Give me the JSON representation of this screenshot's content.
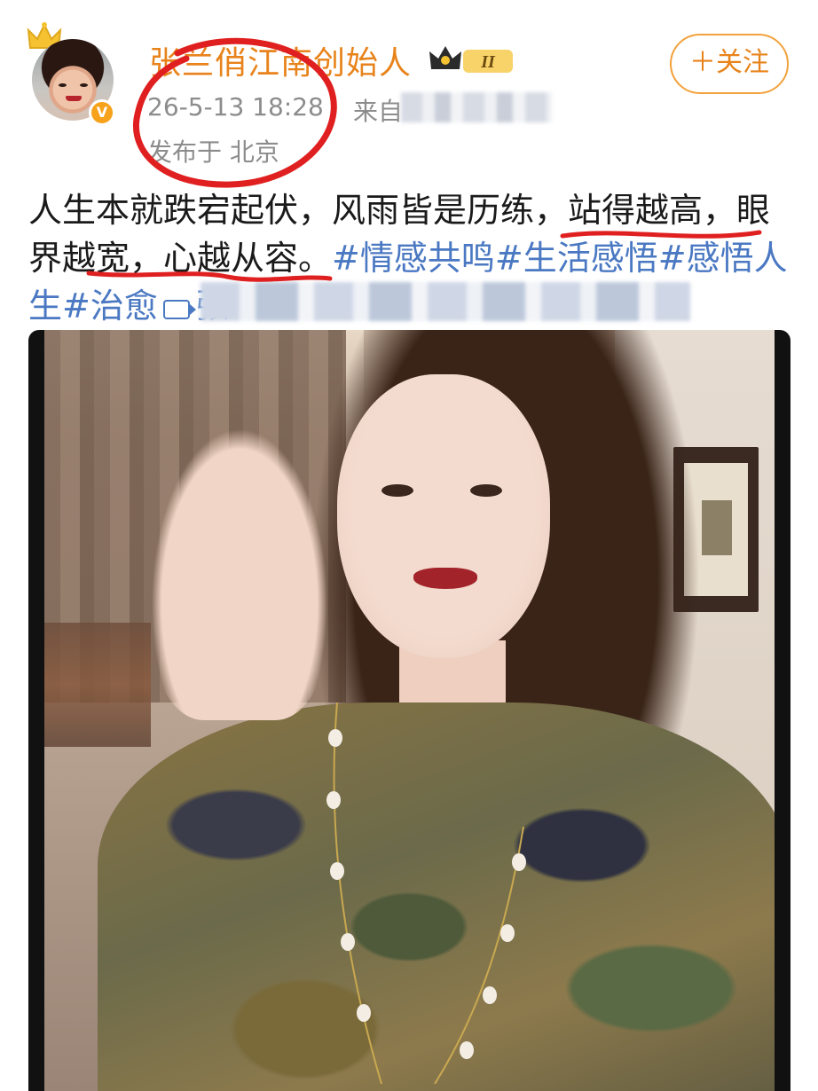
{
  "header": {
    "username": "张兰俏江南创始人",
    "level_badge": "II",
    "post_time": "26-5-13 18:28",
    "post_source": "来自",
    "location": "发布于 北京",
    "follow_label": "＋关注"
  },
  "post": {
    "line1_a": "人生本就跌宕起伏，风雨皆是历练，",
    "line1_b": "站得越高，",
    "line1_c": "眼",
    "line2_a": "界越宽，",
    "line2_b": "心越从容",
    "line2_c": "。",
    "line2_tags": "#情感共鸣#生活感悟#感悟人",
    "line3_tag": "生#治愈",
    "line3_video": "张"
  },
  "colors": {
    "accent": "#e8831b",
    "link": "#4a78c2",
    "annotation_red": "#e02020"
  },
  "icons": [
    "crown-icon",
    "verified-badge-icon",
    "level-badge-icon",
    "video-icon"
  ]
}
